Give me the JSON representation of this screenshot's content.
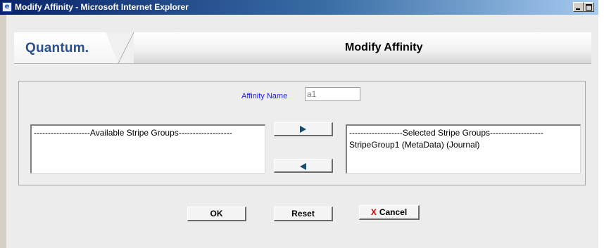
{
  "window": {
    "title": "Modify Affinity - Microsoft Internet Explorer",
    "icons": {
      "app": "ie-page-icon",
      "minimize": "minimize-icon",
      "maximize": "maximize-icon"
    }
  },
  "header": {
    "logo_text": "Quantum.",
    "page_title": "Modify Affinity",
    "brand_color": "#2a4f8e"
  },
  "form": {
    "affinity_name_label": "Affinity Name",
    "affinity_name_value": "a1",
    "available_list": {
      "header": "--------------------Available Stripe Groups-------------------",
      "items": []
    },
    "selected_list": {
      "header": "-------------------Selected Stripe Groups-------------------",
      "items": [
        "StripeGroup1 (MetaData) (Journal)"
      ]
    },
    "move_right_icon": "arrow-right-icon",
    "move_left_icon": "arrow-left-icon"
  },
  "actions": {
    "ok_label": "OK",
    "reset_label": "Reset",
    "cancel_label": "Cancel",
    "cancel_icon_glyph": "X",
    "cancel_icon_color": "#d40000"
  }
}
